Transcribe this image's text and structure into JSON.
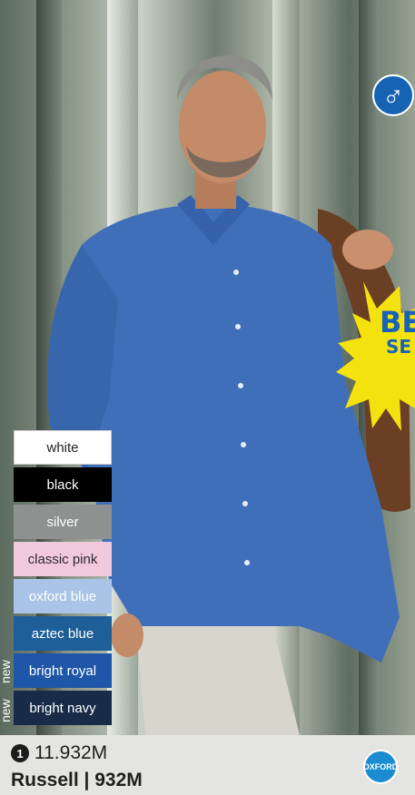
{
  "colors": {
    "brand_blue": "#1763b3",
    "shirt_blue": "#3f6fb8",
    "footer_bg": "#e4e5e1"
  },
  "badge": {
    "gender_icon": "male-symbol-icon",
    "gender_glyph": "♂",
    "splash_line1": "BE",
    "splash_line2": "SE"
  },
  "swatches": [
    {
      "label": "white",
      "color": "#ffffff"
    },
    {
      "label": "black",
      "color": "#000000"
    },
    {
      "label": "silver",
      "color": "#8f9090"
    },
    {
      "label": "classic pink",
      "color": "#f1c9dd"
    },
    {
      "label": "oxford blue",
      "color": "#a9c4e6"
    },
    {
      "label": "aztec blue",
      "color": "#1f5f99"
    },
    {
      "label": "bright royal",
      "color": "#1e56a8"
    },
    {
      "label": "bright navy",
      "color": "#182b48"
    }
  ],
  "new_tags": [
    "new",
    "new"
  ],
  "product": {
    "index_badge": "1",
    "code": "11.932M",
    "name": "Russell | 932M",
    "brand_logo_text": "OXFORD"
  }
}
